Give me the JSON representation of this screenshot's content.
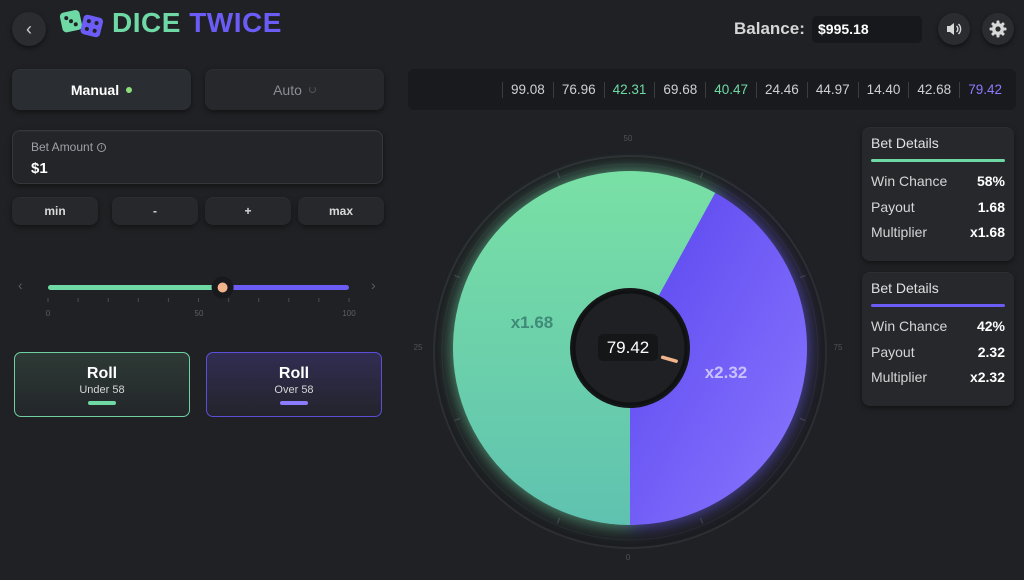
{
  "app": {
    "title_part1": "DICE",
    "title_part2": "TWICE"
  },
  "header": {
    "balance_label": "Balance:",
    "balance_value": "$995.18"
  },
  "modes": {
    "manual": "Manual",
    "auto": "Auto"
  },
  "history": [
    {
      "value": "99.08",
      "color": "#cfd0d2"
    },
    {
      "value": "76.96",
      "color": "#cfd0d2"
    },
    {
      "value": "42.31",
      "color": "#6fd9a6"
    },
    {
      "value": "69.68",
      "color": "#cfd0d2"
    },
    {
      "value": "40.47",
      "color": "#6fd9a6"
    },
    {
      "value": "24.46",
      "color": "#cfd0d2"
    },
    {
      "value": "44.97",
      "color": "#cfd0d2"
    },
    {
      "value": "14.40",
      "color": "#cfd0d2"
    },
    {
      "value": "42.68",
      "color": "#cfd0d2"
    },
    {
      "value": "79.42",
      "color": "#8b7bff"
    }
  ],
  "bet": {
    "label": "Bet Amount",
    "value": "$1"
  },
  "quick_buttons": {
    "min": "min",
    "minus": "-",
    "plus": "+",
    "max": "max"
  },
  "slider": {
    "value": 58,
    "min_label": "0",
    "mid_label": "50",
    "max_label": "100"
  },
  "roll_under": {
    "title": "Roll",
    "sub": "Under 58"
  },
  "roll_over": {
    "title": "Roll",
    "sub": "Over 58"
  },
  "details_under": {
    "title": "Bet Details",
    "win_chance_label": "Win Chance",
    "win_chance": "58%",
    "payout_label": "Payout",
    "payout": "1.68",
    "multiplier_label": "Multiplier",
    "multiplier": "x1.68"
  },
  "details_over": {
    "title": "Bet Details",
    "win_chance_label": "Win Chance",
    "win_chance": "42%",
    "payout_label": "Payout",
    "payout": "2.32",
    "multiplier_label": "Multiplier",
    "multiplier": "x2.32"
  },
  "wheel": {
    "result": "79.42",
    "under_multiplier": "x1.68",
    "over_multiplier": "x2.32",
    "under_share": 0.58,
    "tick_top": "50",
    "tick_right": "75",
    "tick_bottom": "0",
    "tick_left": "25",
    "colors": {
      "green": "#6fd9a6",
      "purple": "#6b5cf6"
    }
  }
}
